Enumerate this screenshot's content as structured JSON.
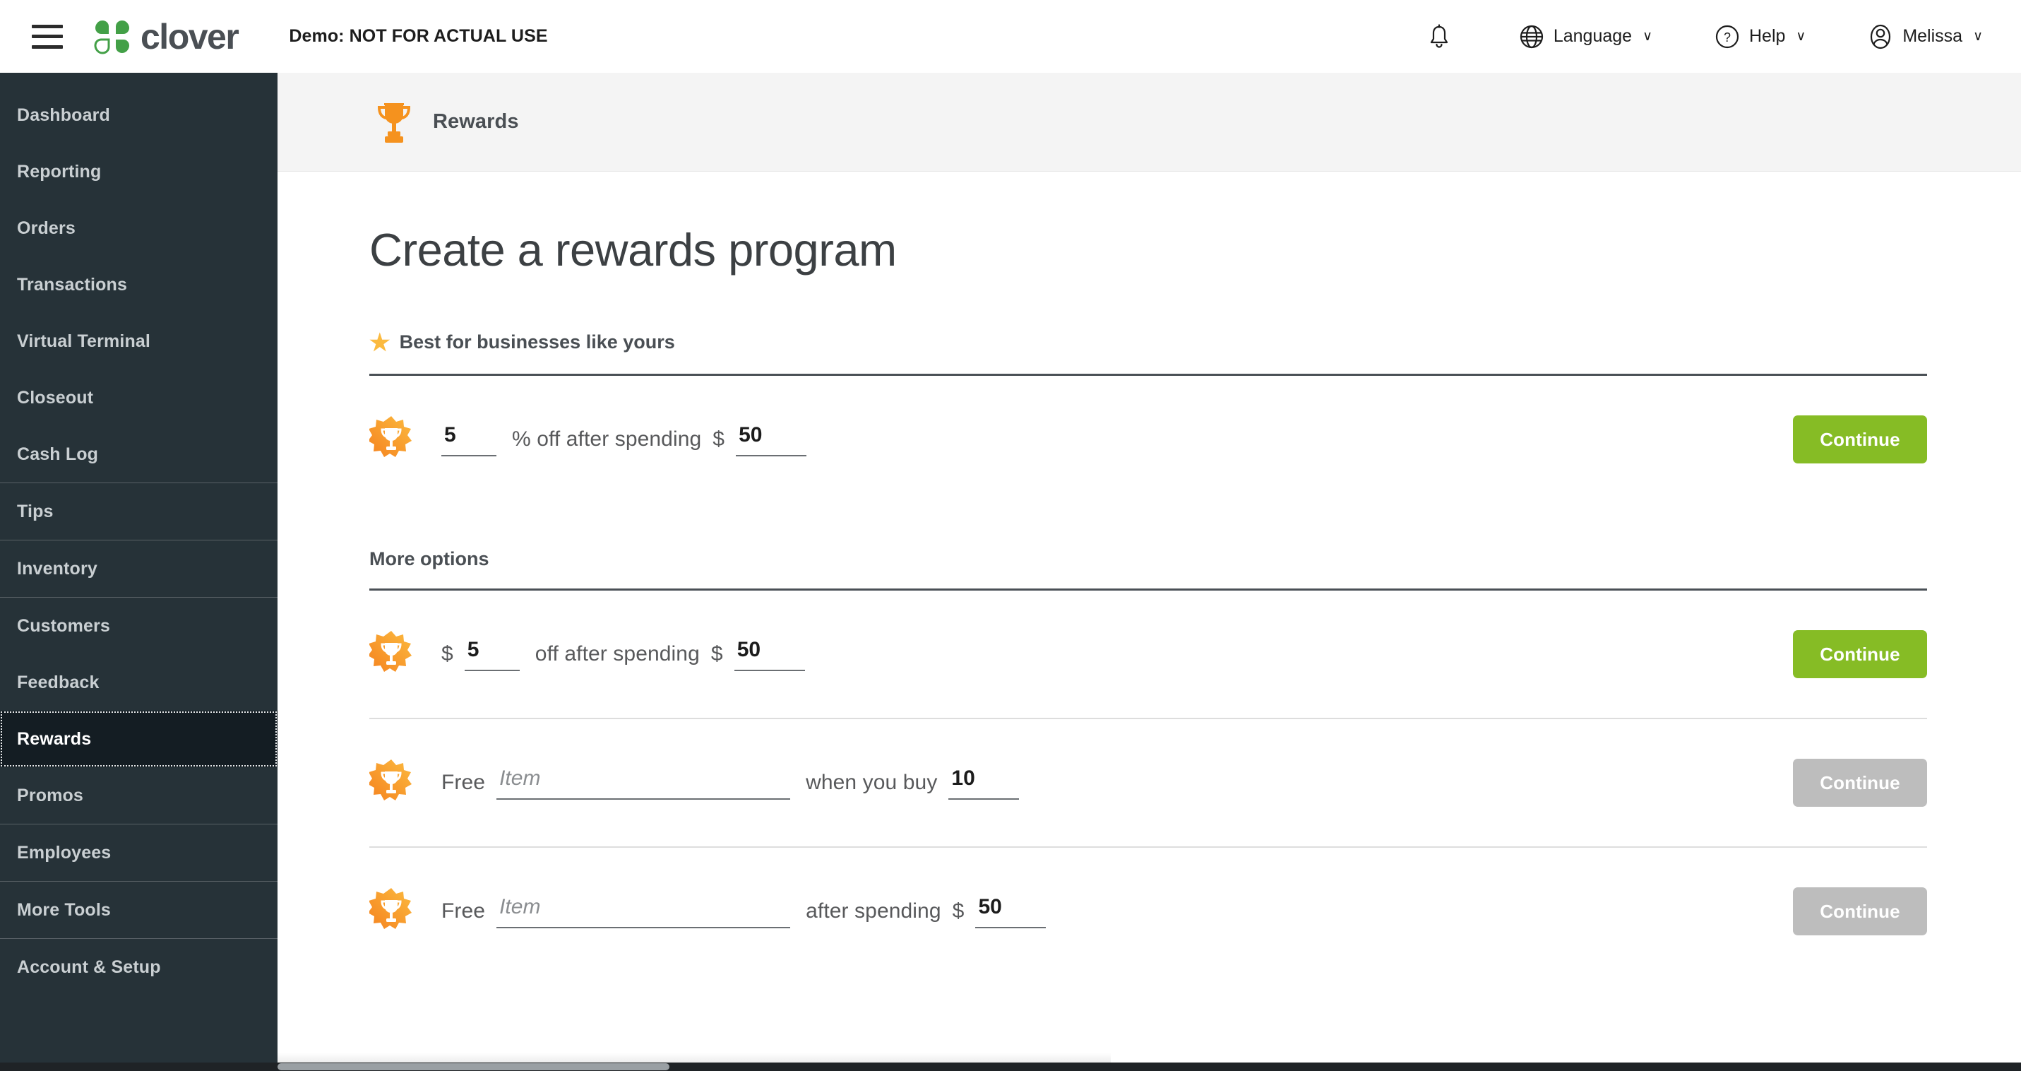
{
  "topbar": {
    "menu_icon": "hamburger-icon",
    "brand": "clover",
    "demo_banner": "Demo: NOT FOR ACTUAL USE",
    "notifications_icon": "bell-icon",
    "language": {
      "label": "Language",
      "icon": "globe-icon",
      "caret": "∨"
    },
    "help": {
      "label": "Help",
      "icon": "question-circle-icon",
      "caret": "∨"
    },
    "account": {
      "label": "Melissa",
      "icon": "user-circle-icon",
      "caret": "∨"
    }
  },
  "sidebar": {
    "items": [
      {
        "label": "Dashboard",
        "active": false
      },
      {
        "label": "Reporting",
        "active": false
      },
      {
        "label": "Orders",
        "active": false
      },
      {
        "label": "Transactions",
        "active": false
      },
      {
        "label": "Virtual Terminal",
        "active": false
      },
      {
        "label": "Closeout",
        "active": false
      },
      {
        "label": "Cash Log",
        "active": false
      },
      {
        "label": "Tips",
        "active": false
      },
      {
        "label": "Inventory",
        "active": false
      },
      {
        "label": "Customers",
        "active": false
      },
      {
        "label": "Feedback",
        "active": false
      },
      {
        "label": "Rewards",
        "active": true
      },
      {
        "label": "Promos",
        "active": false
      },
      {
        "label": "Employees",
        "active": false
      },
      {
        "label": "More Tools",
        "active": false
      },
      {
        "label": "Account & Setup",
        "active": false
      }
    ]
  },
  "page_header": {
    "icon": "trophy-icon",
    "title": "Rewards"
  },
  "main": {
    "title": "Create a rewards program",
    "recommended_label": "Best for businesses like yours",
    "recommended_star_icon": "star-icon",
    "more_options_label": "More options",
    "rows": [
      {
        "icon": "reward-badge-icon",
        "segments": [
          {
            "type": "input",
            "name": "percent-off-input",
            "value": "5",
            "width": "num"
          },
          {
            "type": "text",
            "value": "% off after spending"
          },
          {
            "type": "text",
            "value": "$"
          },
          {
            "type": "input",
            "name": "spend-threshold-input",
            "value": "50",
            "width": "num-wide"
          }
        ],
        "button": {
          "label": "Continue",
          "enabled": true
        }
      },
      {
        "icon": "reward-badge-icon",
        "segments": [
          {
            "type": "text",
            "value": "$"
          },
          {
            "type": "input",
            "name": "dollar-off-input",
            "value": "5",
            "width": "num"
          },
          {
            "type": "text",
            "value": "off after spending"
          },
          {
            "type": "text",
            "value": "$"
          },
          {
            "type": "input",
            "name": "spend-threshold-input",
            "value": "50",
            "width": "num-wide"
          }
        ],
        "button": {
          "label": "Continue",
          "enabled": true
        }
      },
      {
        "icon": "reward-badge-icon",
        "segments": [
          {
            "type": "text",
            "value": "Free"
          },
          {
            "type": "input",
            "name": "free-item-input",
            "value": "",
            "placeholder": "Item",
            "width": "item"
          },
          {
            "type": "text",
            "value": "when you buy"
          },
          {
            "type": "input",
            "name": "buy-quantity-input",
            "value": "10",
            "width": "num-wide"
          }
        ],
        "button": {
          "label": "Continue",
          "enabled": false
        }
      },
      {
        "icon": "reward-badge-icon",
        "segments": [
          {
            "type": "text",
            "value": "Free"
          },
          {
            "type": "input",
            "name": "free-item-input",
            "value": "",
            "placeholder": "Item",
            "width": "item"
          },
          {
            "type": "text",
            "value": "after spending"
          },
          {
            "type": "text",
            "value": "$"
          },
          {
            "type": "input",
            "name": "spend-threshold-input",
            "value": "50",
            "width": "num-wide"
          }
        ],
        "button": {
          "label": "Continue",
          "enabled": false
        }
      }
    ]
  },
  "colors": {
    "sidebar_bg": "#263238",
    "sidebar_active_bg": "#141d23",
    "accent_green": "#86bc25",
    "disabled_gray": "#bdbdbd",
    "badge_orange": "#f5821f",
    "badge_yellow": "#fbba3f",
    "clover_green": "#4caf50"
  }
}
